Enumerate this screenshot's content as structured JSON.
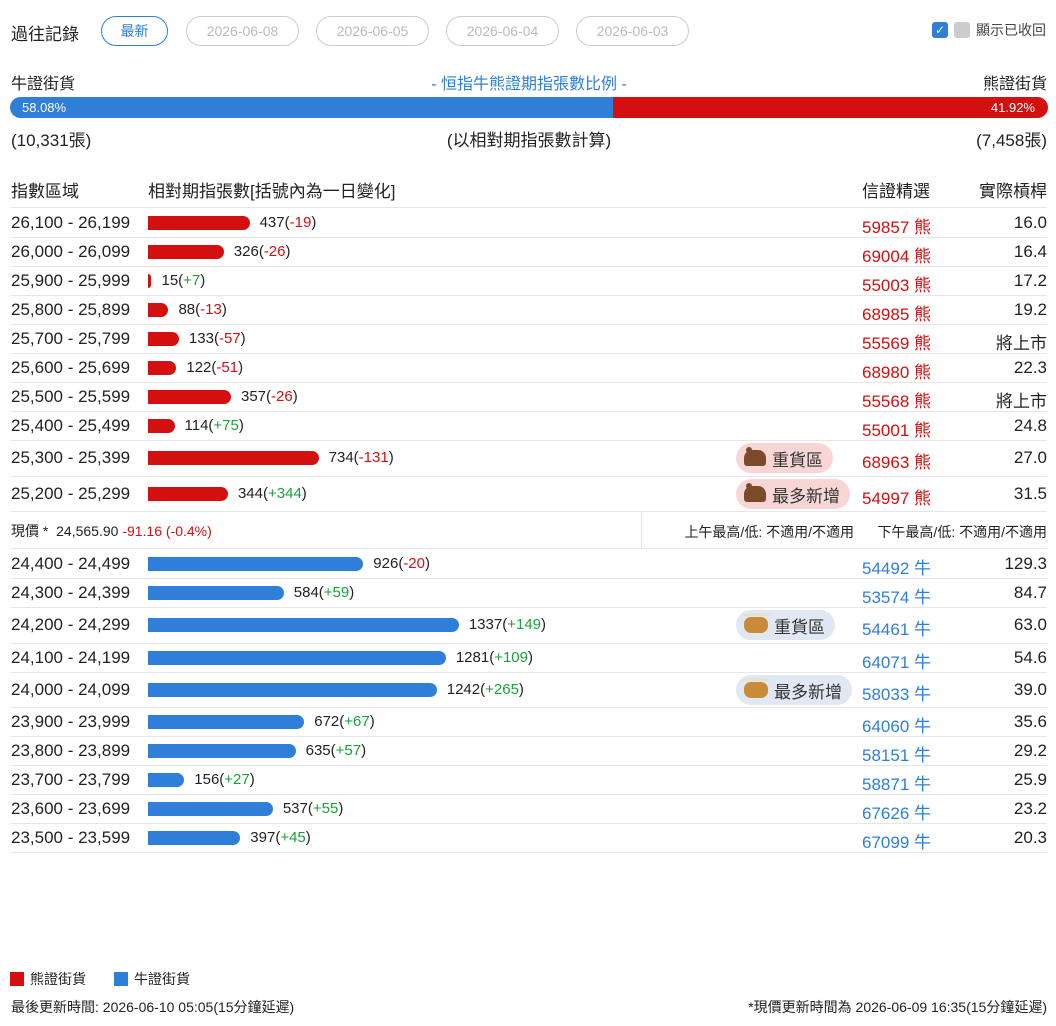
{
  "history": {
    "label": "過往記錄",
    "chips": [
      "最新",
      "2026-06-08",
      "2026-06-05",
      "2026-06-04",
      "2026-06-03"
    ],
    "show_collapsed_label": "顯示已收回"
  },
  "ratio": {
    "bull_label": "牛證街貨",
    "bear_label": "熊證街貨",
    "title": "- 恒指牛熊證期指張數比例 -",
    "bull_percent": "58.08%",
    "bear_percent": "41.92%",
    "bull_fraction": 0.5808,
    "bull_count": "(10,331張)",
    "bear_count": "(7,458張)",
    "basis": "(以相對期指張數計算)"
  },
  "table_header": {
    "range": "指數區域",
    "contracts": "相對期指張數[括號內為一日變化]",
    "pick": "信證精選",
    "leverage": "實際槓桿"
  },
  "bear_rows": [
    {
      "range": "26,100 - 26,199",
      "qty": "437",
      "chg": "-19",
      "code": "59857",
      "type": "熊",
      "lev": "16.0",
      "tag": ""
    },
    {
      "range": "26,000 - 26,099",
      "qty": "326",
      "chg": "-26",
      "code": "69004",
      "type": "熊",
      "lev": "16.4",
      "tag": ""
    },
    {
      "range": "25,900 - 25,999",
      "qty": "15",
      "chg": "+7",
      "code": "55003",
      "type": "熊",
      "lev": "17.2",
      "tag": ""
    },
    {
      "range": "25,800 - 25,899",
      "qty": "88",
      "chg": "-13",
      "code": "68985",
      "type": "熊",
      "lev": "19.2",
      "tag": ""
    },
    {
      "range": "25,700 - 25,799",
      "qty": "133",
      "chg": "-57",
      "code": "55569",
      "type": "熊",
      "lev": "將上市",
      "tag": ""
    },
    {
      "range": "25,600 - 25,699",
      "qty": "122",
      "chg": "-51",
      "code": "68980",
      "type": "熊",
      "lev": "22.3",
      "tag": ""
    },
    {
      "range": "25,500 - 25,599",
      "qty": "357",
      "chg": "-26",
      "code": "55568",
      "type": "熊",
      "lev": "將上市",
      "tag": ""
    },
    {
      "range": "25,400 - 25,499",
      "qty": "114",
      "chg": "+75",
      "code": "55001",
      "type": "熊",
      "lev": "24.8",
      "tag": ""
    },
    {
      "range": "25,300 - 25,399",
      "qty": "734",
      "chg": "-131",
      "code": "68963",
      "type": "熊",
      "lev": "27.0",
      "tag": "重貨區"
    },
    {
      "range": "25,200 - 25,299",
      "qty": "344",
      "chg": "+344",
      "code": "54997",
      "type": "熊",
      "lev": "31.5",
      "tag": "最多新增"
    }
  ],
  "price": {
    "label": "現價 *",
    "value": "24,565.90",
    "change": "-91.16 (-0.4%)",
    "am": "上午最高/低: 不適用/不適用",
    "pm": "下午最高/低: 不適用/不適用"
  },
  "bull_rows": [
    {
      "range": "24,400 - 24,499",
      "qty": "926",
      "chg": "-20",
      "code": "54492",
      "type": "牛",
      "lev": "129.3",
      "tag": ""
    },
    {
      "range": "24,300 - 24,399",
      "qty": "584",
      "chg": "+59",
      "code": "53574",
      "type": "牛",
      "lev": "84.7",
      "tag": ""
    },
    {
      "range": "24,200 - 24,299",
      "qty": "1337",
      "chg": "+149",
      "code": "54461",
      "type": "牛",
      "lev": "63.0",
      "tag": "重貨區"
    },
    {
      "range": "24,100 - 24,199",
      "qty": "1281",
      "chg": "+109",
      "code": "64071",
      "type": "牛",
      "lev": "54.6",
      "tag": ""
    },
    {
      "range": "24,000 - 24,099",
      "qty": "1242",
      "chg": "+265",
      "code": "58033",
      "type": "牛",
      "lev": "39.0",
      "tag": "最多新增"
    },
    {
      "range": "23,900 - 23,999",
      "qty": "672",
      "chg": "+67",
      "code": "64060",
      "type": "牛",
      "lev": "35.6",
      "tag": ""
    },
    {
      "range": "23,800 - 23,899",
      "qty": "635",
      "chg": "+57",
      "code": "58151",
      "type": "牛",
      "lev": "29.2",
      "tag": ""
    },
    {
      "range": "23,700 - 23,799",
      "qty": "156",
      "chg": "+27",
      "code": "58871",
      "type": "牛",
      "lev": "25.9",
      "tag": ""
    },
    {
      "range": "23,600 - 23,699",
      "qty": "537",
      "chg": "+55",
      "code": "67626",
      "type": "牛",
      "lev": "23.2",
      "tag": ""
    },
    {
      "range": "23,500 - 23,599",
      "qty": "397",
      "chg": "+45",
      "code": "67099",
      "type": "牛",
      "lev": "20.3",
      "tag": ""
    }
  ],
  "legend": {
    "bear": "熊證街貨",
    "bull": "牛證街貨",
    "bear_color": "#d40f0f",
    "bull_color": "#2f7fd9"
  },
  "footer": {
    "updated": "最後更新時間: 2026-06-10 05:05(15分鐘延遲)",
    "price_note": "*現價更新時間為 2026-06-09 16:35(15分鐘延遲)"
  }
}
